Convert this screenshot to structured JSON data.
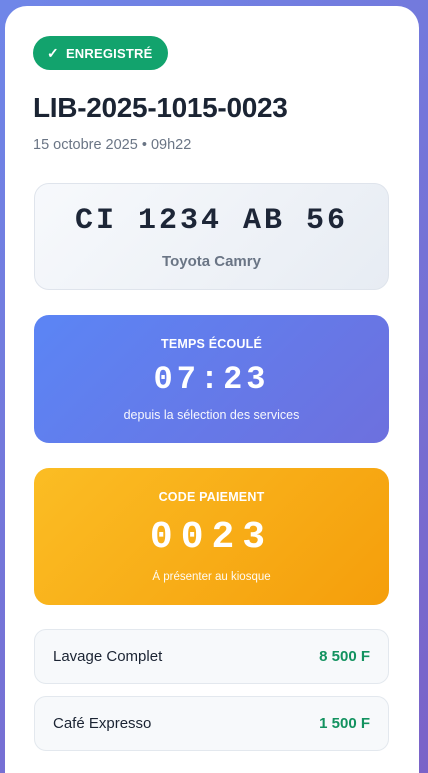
{
  "ticket": {
    "status_label": "ENREGISTRÉ",
    "status_icon": "check-icon",
    "status_color": "#12a36d",
    "reference": "LIB-2025-1015-0023",
    "datetime": "15 octobre 2025 • 09h22"
  },
  "vehicle": {
    "plate": "CI 1234 AB 56",
    "model": "Toyota Camry"
  },
  "timer": {
    "label": "TEMPS ÉCOULÉ",
    "value": "07:23",
    "caption": "depuis la sélection des services",
    "color": "#5b85f5"
  },
  "payment": {
    "label": "CODE PAIEMENT",
    "code": "0023",
    "caption": "À présenter au kiosque",
    "color": "#fbbd24"
  },
  "services": [
    {
      "name": "Lavage Complet",
      "price": "8 500 F"
    },
    {
      "name": "Café Expresso",
      "price": "1 500 F"
    }
  ],
  "colors": {
    "price": "#12925f",
    "title": "#1b2433"
  }
}
